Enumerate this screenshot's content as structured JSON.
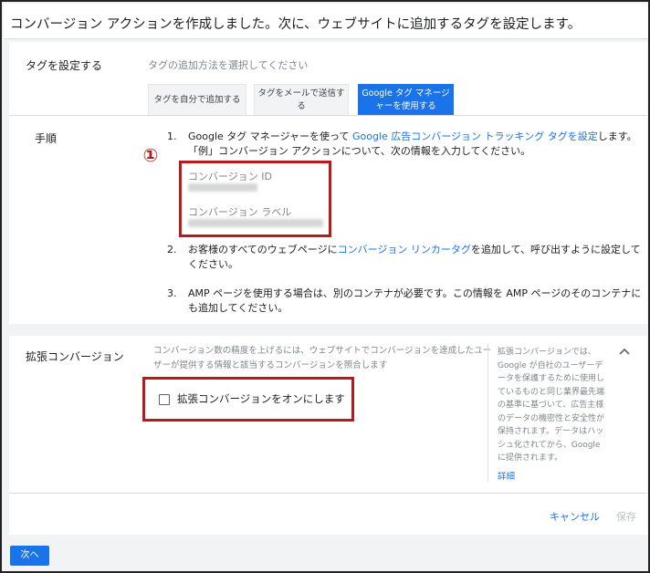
{
  "header": {
    "title": "コンバージョン アクションを作成しました。次に、ウェブサイトに追加するタグを設定します。"
  },
  "tag_setup": {
    "label": "タグを設定する",
    "hint": "タグの追加方法を選択してください",
    "tabs": [
      {
        "label_line1": "タグを自分で追加する",
        "label_line2": "",
        "active": false
      },
      {
        "label_line1": "タグをメールで送信す",
        "label_line2": "る",
        "active": false
      },
      {
        "label_line1": "Google タグ マネージ",
        "label_line2": "ャーを使用する",
        "active": true
      }
    ]
  },
  "steps": {
    "label": "手順",
    "step1_num": "1.",
    "step1_pre": "Google タグ マネージャーを使って ",
    "step1_link": "Google 広告コンバージョン トラッキング タグを設定",
    "step1_post": "します。",
    "step1_line2": "「例」コンバージョン アクションについて、次の情報を入力してください。",
    "badge": "①",
    "conversion_id_label": "コンバージョン ID",
    "conversion_label_label": "コンバージョン ラベル",
    "step2_num": "2.",
    "step2_pre": "お客様のすべてのウェブページに",
    "step2_link": "コンバージョン リンカータグ",
    "step2_post": "を追加して、呼び出すように設定して",
    "step2_line2": "ください。",
    "step3_num": "3.",
    "step3_line1": "AMP ページを使用する場合は、別のコンテナが必要です。この情報を AMP ページのそのコンテナに",
    "step3_line2": "も追加してください。"
  },
  "enhanced": {
    "label": "拡張コンバージョン",
    "desc_line1": "コンバージョン数の精度を上げるには、ウェブサイトでコンバージョンを達成したユー",
    "desc_line2": "ザーが提供する情報と該当するコンバージョンを照合します",
    "checkbox_label": "拡張コンバージョンをオンにします",
    "checked": false,
    "side_lines": [
      "拡張コンバージョンでは、",
      "Google が自社のユーザーデ",
      "ータを保護するために使用し",
      "ているものと同じ業界最先端",
      "の基準に基づいて、広告主様",
      "のデータの機密性と安全性が",
      "保持されます。データはハッ",
      "シュ化されてから、Google",
      "に提供されます。"
    ],
    "details_link": "詳細",
    "collapse_icon": "chevron-up-icon"
  },
  "actions": {
    "cancel": "キャンセル",
    "save": "保存",
    "next": "次へ"
  },
  "colors": {
    "accent": "#1a73e8",
    "highlight_box": "#b71c1c"
  }
}
